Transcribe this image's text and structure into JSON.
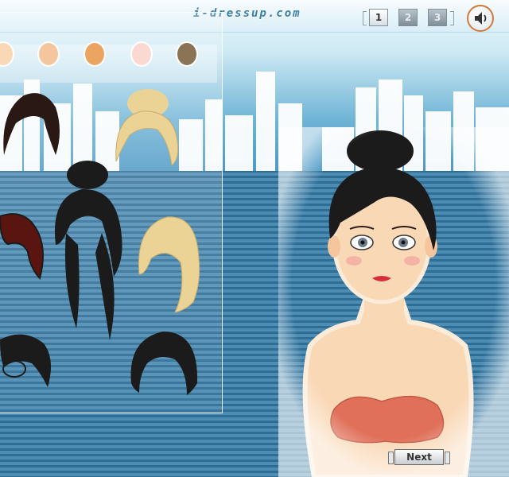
{
  "header": {
    "site_name": "i-dressup.com",
    "pages": [
      {
        "label": "1",
        "active": true
      },
      {
        "label": "2",
        "active": false
      },
      {
        "label": "3",
        "active": false
      }
    ]
  },
  "skin_swatches": [
    {
      "color": "#f9d8b6"
    },
    {
      "color": "#f5c69d"
    },
    {
      "color": "#eba461"
    },
    {
      "color": "#fbd9d2"
    },
    {
      "color": "#8b7455"
    }
  ],
  "hair_colors": {
    "black": "#1b1b1b",
    "dark_brown": "#2a1814",
    "auburn": "#5a1511",
    "blonde": "#ebd395"
  },
  "next_label": "Next",
  "colors": {
    "accent": "#d27a3a",
    "panel_stripe": "#4d8cb3"
  }
}
